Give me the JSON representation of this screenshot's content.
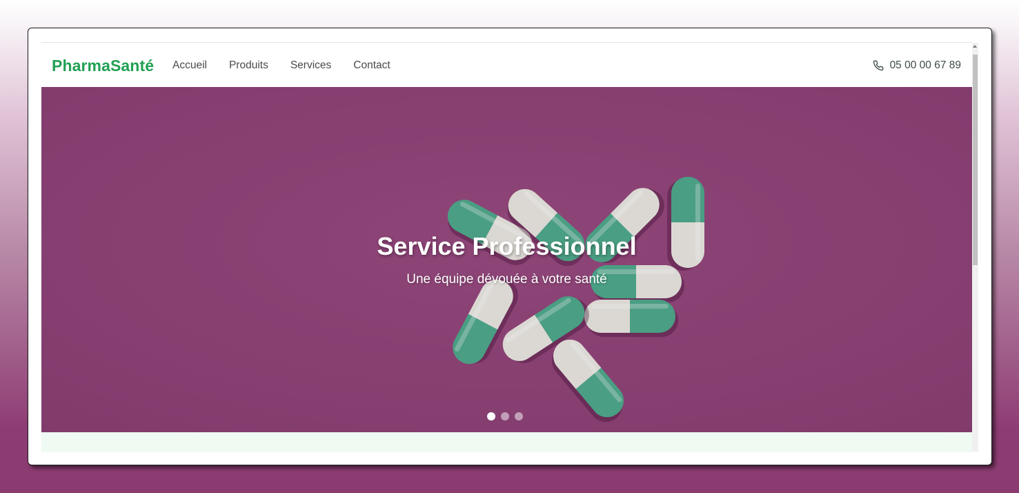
{
  "navbar": {
    "brand": "PharmaSanté",
    "links": [
      "Accueil",
      "Produits",
      "Services",
      "Contact"
    ],
    "phone": "05 00 00 67 89",
    "phone_icon": "phone-icon"
  },
  "hero": {
    "title": "Service Professionnel",
    "subtitle": "Une équipe dévouée à votre santé",
    "slide_count": 3,
    "active_slide": 1,
    "background_color": "#8f4479",
    "capsule_colors": [
      "#4fa88c",
      "#e9e6e1"
    ]
  },
  "colors": {
    "brand": "#22a054",
    "next_section_bg": "#effaf3"
  }
}
